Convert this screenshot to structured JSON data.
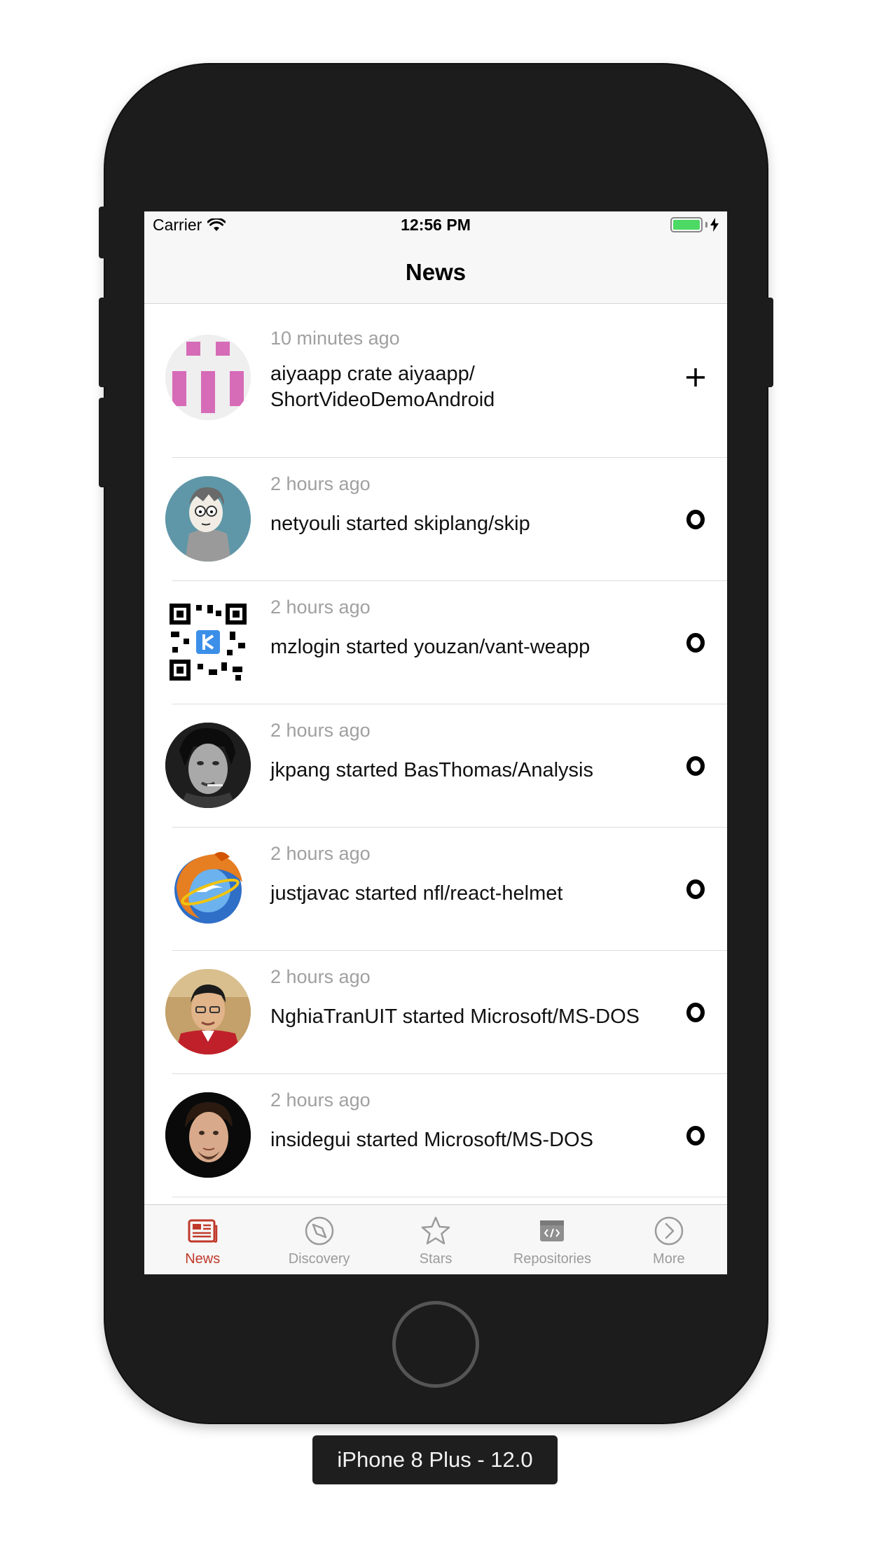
{
  "status_bar": {
    "carrier": "Carrier",
    "time": "12:56 PM"
  },
  "nav": {
    "title": "News"
  },
  "feed": [
    {
      "time": "10 minutes ago",
      "text": "aiyaapp crate  aiyaapp/ ShortVideoDemoAndroid",
      "action_icon": "plus-icon",
      "avatar": "identicon-avatar"
    },
    {
      "time": "2 hours ago",
      "text": "netyouli started skiplang/skip",
      "action_icon": "ring-icon",
      "avatar": "cartoon-avatar"
    },
    {
      "time": "2 hours ago",
      "text": "mzlogin started youzan/vant-weapp",
      "action_icon": "ring-icon",
      "avatar": "qr-avatar"
    },
    {
      "time": "2 hours ago",
      "text": "jkpang started BasThomas/Analysis",
      "action_icon": "ring-icon",
      "avatar": "photo-avatar"
    },
    {
      "time": "2 hours ago",
      "text": "justjavac started nfl/react-helmet",
      "action_icon": "ring-icon",
      "avatar": "browser-logo-avatar"
    },
    {
      "time": "2 hours ago",
      "text": "NghiaTranUIT started Microsoft/MS-DOS",
      "action_icon": "ring-icon",
      "avatar": "photo-avatar"
    },
    {
      "time": "2 hours ago",
      "text": "insidegui started Microsoft/MS-DOS",
      "action_icon": "ring-icon",
      "avatar": "photo-avatar"
    }
  ],
  "tabs": [
    {
      "label": "News",
      "icon": "newspaper-icon",
      "active": true
    },
    {
      "label": "Discovery",
      "icon": "compass-icon",
      "active": false
    },
    {
      "label": "Stars",
      "icon": "star-icon",
      "active": false
    },
    {
      "label": "Repositories",
      "icon": "code-box-icon",
      "active": false
    },
    {
      "label": "More",
      "icon": "chevron-circle-icon",
      "active": false
    }
  ],
  "device_label": "iPhone 8 Plus - 12.0",
  "colors": {
    "accent": "#c0392b",
    "inactive_tab": "#9b9b9b",
    "battery": "#4cd964"
  }
}
